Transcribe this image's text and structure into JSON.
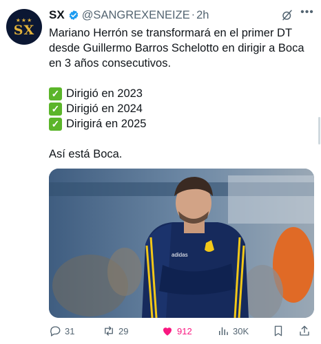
{
  "tweet": {
    "author_name": "SX",
    "handle": "@SANGREXENEIZE",
    "separator": "·",
    "time": "2h",
    "avatar_text": "SX",
    "avatar_stars": "★★★",
    "text_lines": [
      "Mariano Herrón se transformará en el primer DT desde Guillermo Barros Schelotto en dirigir a Boca en 3 años consecutivos."
    ],
    "checklist": [
      {
        "icon": "check-box-icon",
        "text": "Dirigió en 2023"
      },
      {
        "icon": "check-box-icon",
        "text": "Dirigió en 2024"
      },
      {
        "icon": "check-box-icon",
        "text": "Dirigirá en 2025"
      }
    ],
    "closing": "Así está Boca.",
    "image_icon": "coach-photo"
  },
  "actions": {
    "replies": "31",
    "retweets": "29",
    "likes": "912",
    "views": "30K"
  },
  "colors": {
    "accent": "#1d9bf0",
    "like": "#f91880",
    "check": "#5bb52a",
    "muted": "#536471",
    "avatar_bg": "#0b1733",
    "avatar_gold": "#e2b23a"
  }
}
